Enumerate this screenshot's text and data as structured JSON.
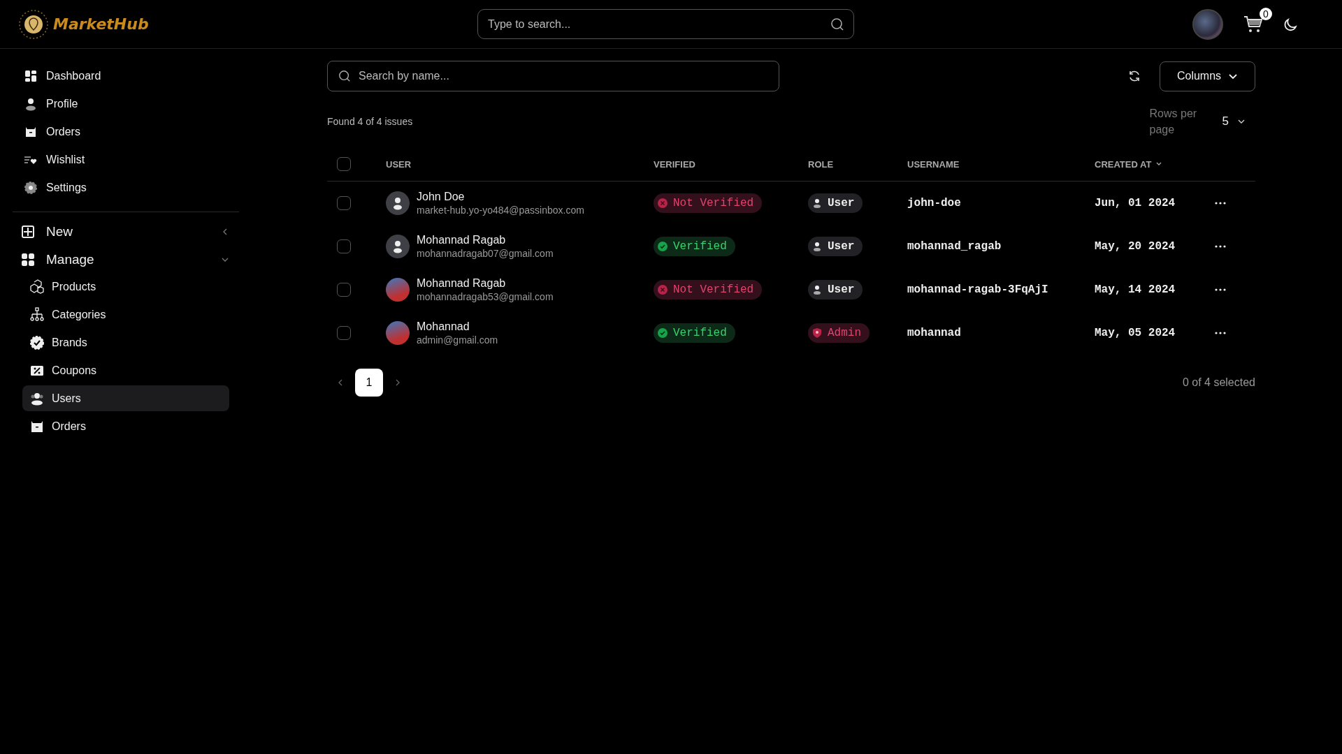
{
  "header": {
    "brand": "MarketHub",
    "search_placeholder": "Type to search...",
    "cart_count": "0"
  },
  "sidebar": {
    "items": [
      {
        "label": "Dashboard",
        "kind": "dashboard",
        "selected": false
      },
      {
        "label": "Profile",
        "kind": "profile",
        "selected": false
      },
      {
        "label": "Orders",
        "kind": "orders",
        "selected": false
      },
      {
        "label": "Wishlist",
        "kind": "wishlist",
        "selected": false
      },
      {
        "label": "Settings",
        "kind": "settings",
        "selected": false
      }
    ],
    "groups": [
      {
        "label": "New",
        "kind": "new",
        "expanded": false
      },
      {
        "label": "Manage",
        "kind": "manage",
        "expanded": true,
        "children": [
          {
            "label": "Products",
            "kind": "products",
            "selected": false
          },
          {
            "label": "Categories",
            "kind": "categories",
            "selected": false
          },
          {
            "label": "Brands",
            "kind": "brands",
            "selected": false
          },
          {
            "label": "Coupons",
            "kind": "coupons",
            "selected": false
          },
          {
            "label": "Users",
            "kind": "users",
            "selected": true
          },
          {
            "label": "Orders",
            "kind": "orders",
            "selected": false
          }
        ]
      }
    ]
  },
  "toolbar": {
    "search_placeholder": "Search by name...",
    "columns_button": "Columns",
    "found_text": "Found 4 of 4 issues",
    "rows_per_page_label": "Rows per page",
    "rows_per_page_value": "5"
  },
  "table": {
    "all_checked": false,
    "columns": [
      {
        "label": "USER",
        "sorted": false
      },
      {
        "label": "VERIFIED",
        "sorted": false
      },
      {
        "label": "ROLE",
        "sorted": false
      },
      {
        "label": "USERNAME",
        "sorted": false
      },
      {
        "label": "CREATED AT",
        "sorted": true
      }
    ],
    "rows": [
      {
        "checked": false,
        "has_photo": false,
        "name": "John Doe",
        "email": "market-hub.yo-yo484@passinbox.com",
        "verified": false,
        "verified_label": "Not Verified",
        "kind": "user",
        "role_label": "User",
        "username": "john-doe",
        "created_at": "Jun, 01 2024"
      },
      {
        "checked": false,
        "has_photo": false,
        "name": "Mohannad Ragab",
        "email": "mohannadragab07@gmail.com",
        "verified": true,
        "verified_label": "Verified",
        "kind": "user",
        "role_label": "User",
        "username": "mohannad_ragab",
        "created_at": "May, 20 2024"
      },
      {
        "checked": false,
        "has_photo": true,
        "name": "Mohannad Ragab",
        "email": "mohannadragab53@gmail.com",
        "verified": false,
        "verified_label": "Not Verified",
        "kind": "user",
        "role_label": "User",
        "username": "mohannad-ragab-3FqAjI",
        "created_at": "May, 14 2024"
      },
      {
        "checked": false,
        "has_photo": true,
        "name": "Mohannad",
        "email": "admin@gmail.com",
        "verified": true,
        "verified_label": "Verified",
        "kind": "admin",
        "role_label": "Admin",
        "username": "mohannad",
        "created_at": "May, 05 2024"
      }
    ]
  },
  "pagination": {
    "pages": [
      {
        "label": "1",
        "selected": true
      }
    ],
    "selection_text": "0 of 4 selected"
  }
}
